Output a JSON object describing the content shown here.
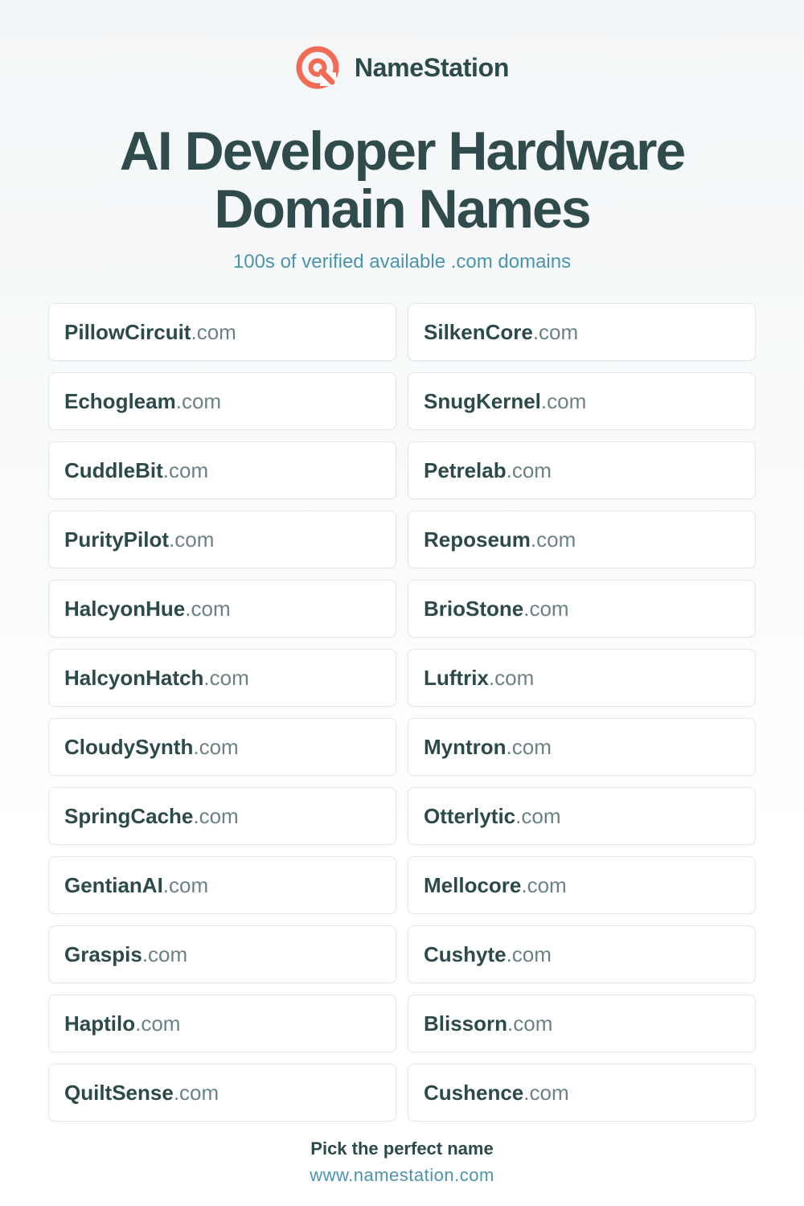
{
  "brand": {
    "name": "NameStation",
    "logo_icon": "namestation-logo-icon",
    "logo_color": "#f26b55"
  },
  "header": {
    "title_line1": "AI Developer Hardware",
    "title_line2": "Domain Names",
    "subtitle": "100s of verified available .com domains"
  },
  "domains": [
    {
      "name": "PillowCircuit",
      "tld": ".com"
    },
    {
      "name": "SilkenCore",
      "tld": ".com"
    },
    {
      "name": "Echogleam",
      "tld": ".com"
    },
    {
      "name": "SnugKernel",
      "tld": ".com"
    },
    {
      "name": "CuddleBit",
      "tld": ".com"
    },
    {
      "name": "Petrelab",
      "tld": ".com"
    },
    {
      "name": "PurityPilot",
      "tld": ".com"
    },
    {
      "name": "Reposeum",
      "tld": ".com"
    },
    {
      "name": "HalcyonHue",
      "tld": ".com"
    },
    {
      "name": "BrioStone",
      "tld": ".com"
    },
    {
      "name": "HalcyonHatch",
      "tld": ".com"
    },
    {
      "name": "Luftrix",
      "tld": ".com"
    },
    {
      "name": "CloudySynth",
      "tld": ".com"
    },
    {
      "name": "Myntron",
      "tld": ".com"
    },
    {
      "name": "SpringCache",
      "tld": ".com"
    },
    {
      "name": "Otterlytic",
      "tld": ".com"
    },
    {
      "name": "GentianAI",
      "tld": ".com"
    },
    {
      "name": "Mellocore",
      "tld": ".com"
    },
    {
      "name": "Graspis",
      "tld": ".com"
    },
    {
      "name": "Cushyte",
      "tld": ".com"
    },
    {
      "name": "Haptilo",
      "tld": ".com"
    },
    {
      "name": "Blissorn",
      "tld": ".com"
    },
    {
      "name": "QuiltSense",
      "tld": ".com"
    },
    {
      "name": "Cushence",
      "tld": ".com"
    }
  ],
  "footer": {
    "tagline": "Pick the perfect name",
    "url": "www.namestation.com"
  },
  "colors": {
    "text_dark": "#2d4a4a",
    "accent_blue": "#4b94ad",
    "tld_gray": "#6c8184",
    "card_border": "#e2e7ea"
  }
}
